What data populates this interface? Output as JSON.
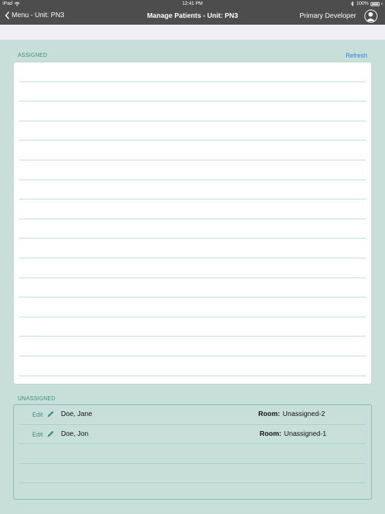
{
  "status_bar": {
    "device": "iPad",
    "time": "12:41 PM",
    "battery": "100%"
  },
  "nav": {
    "back_label": "Menu - Unit: PN3",
    "title": "Manage Patients - Unit: PN3",
    "user_name": "Primary Developer"
  },
  "assigned": {
    "label": "ASSIGNED",
    "refresh_label": "Refresh",
    "rows": []
  },
  "unassigned": {
    "label": "UNASSIGNED",
    "edit_label": "Edit",
    "room_label": "Room:",
    "patients": [
      {
        "name": "Doe, Jane",
        "room": "Unassigned-2"
      },
      {
        "name": "Doe, Jon",
        "room": "Unassigned-1"
      }
    ]
  },
  "colors": {
    "header": "#4d4d4d",
    "background": "#c8dfd9",
    "accent": "#3a8f7e",
    "link": "#2b7de9"
  }
}
